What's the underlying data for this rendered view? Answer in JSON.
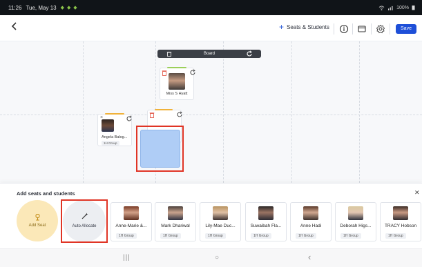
{
  "status_bar": {
    "time": "11:26",
    "date": "Tue, May 13",
    "notif_icons": "◆ ◆ ◆",
    "battery": "100%"
  },
  "header": {
    "back_icon": "chevron-left-icon",
    "seats_button_label": "Seats & Students",
    "save_label": "Save",
    "accent_color": "#1e4fd8"
  },
  "canvas": {
    "board_label": "Board",
    "seats": [
      {
        "name": "Miss S Hyatt",
        "group": "",
        "accent": "#9bcf5a"
      },
      {
        "name": "Angela Balog...",
        "group": "1H Group",
        "accent": "#f0b23a"
      },
      {
        "name": "",
        "group": "",
        "accent": "#f0b23a"
      }
    ]
  },
  "panel": {
    "title": "Add seats and students",
    "close_icon": "close-icon",
    "add_seat_label": "Add Seat",
    "auto_allocate_label": "Auto Allocate",
    "students": [
      {
        "name": "Anne-Marie &...",
        "group": "1H Group"
      },
      {
        "name": "Mark Dhariwal",
        "group": "1H Group"
      },
      {
        "name": "Lily-Mae Duc...",
        "group": "1H Group"
      },
      {
        "name": "Suwaibah Fla...",
        "group": "1H Group"
      },
      {
        "name": "Anne Hadi",
        "group": "1H Group"
      },
      {
        "name": "Deborah Higs...",
        "group": "1H Group"
      },
      {
        "name": "TRACY Hobson",
        "group": "1H Group"
      }
    ]
  },
  "nav": {
    "recents": "|||",
    "home": "○",
    "back": "‹"
  },
  "colors": {
    "highlight": "#e03425",
    "drop_zone": "#afcdf6",
    "add_seat_bg": "#fbe8b8"
  }
}
